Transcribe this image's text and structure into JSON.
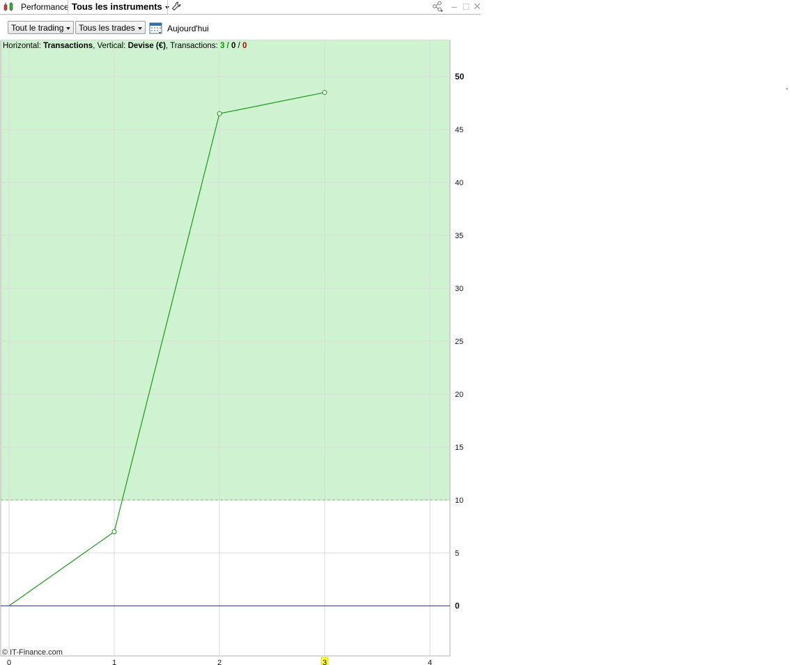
{
  "window": {
    "tab_title": "Performance",
    "instrument_select": "Tous les instruments",
    "icons": [
      "candlestick-chart-icon",
      "wrench-icon",
      "share-icon",
      "minimize-icon",
      "maximize-icon",
      "close-icon"
    ]
  },
  "toolbar": {
    "trading_filter": "Tout le trading",
    "trades_filter": "Tous les trades",
    "date_label": "Aujourd'hui"
  },
  "info_bar": {
    "horizontal_prefix": "Horizontal: ",
    "horizontal_value": "Transactions",
    "vertical_prefix": ", Vertical: ",
    "vertical_value": "Devise (€)",
    "transactions_prefix": ", Transactions: ",
    "tx_win": "3",
    "tx_sep1": " / ",
    "tx_neutral": "0",
    "tx_sep2": " / ",
    "tx_loss": "0"
  },
  "copyright": "© IT-Finance.com",
  "chart_data": {
    "type": "line",
    "x": [
      0,
      1,
      2,
      3
    ],
    "y": [
      0,
      7,
      46.5,
      48.5
    ],
    "xlim": [
      0,
      4
    ],
    "ylim": [
      0,
      50
    ],
    "x_ticks": [
      "0",
      "1",
      "2",
      "3",
      "4"
    ],
    "y_ticks": [
      "0",
      "5",
      "10",
      "15",
      "20",
      "25",
      "30",
      "35",
      "40",
      "45",
      "50"
    ],
    "highlighted_x_tick": "3",
    "threshold": 10,
    "grid": true,
    "colors": {
      "line": "#1a9a1a",
      "zone_fill": "#cff2d0",
      "threshold_line": "#6cc06c",
      "zero_line": "#1a237e",
      "grid": "#d9d9d9",
      "highlight_tick_bg": "#ffff33"
    }
  }
}
